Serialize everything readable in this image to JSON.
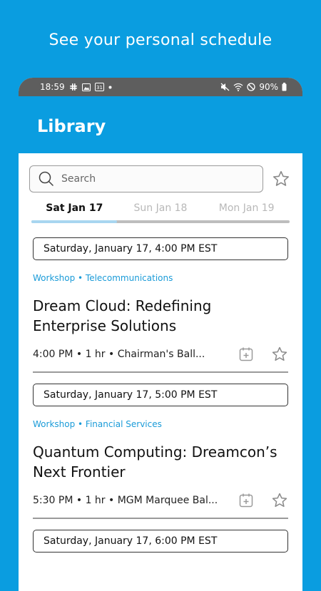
{
  "banner": {
    "text": "See your personal schedule"
  },
  "statusbar": {
    "time": "18:59",
    "battery": "90%",
    "calendar_day": "31"
  },
  "header": {
    "title": "Library"
  },
  "search": {
    "placeholder": "Search"
  },
  "tabs": [
    {
      "label": "Sat Jan 17",
      "active": true
    },
    {
      "label": "Sun Jan 18",
      "active": false
    },
    {
      "label": "Mon Jan 19",
      "active": false
    }
  ],
  "sessions": [
    {
      "time_header": "Saturday, January 17,  4:00 PM EST",
      "tags": "Workshop • Telecommunications",
      "title": "Dream Cloud: Redefining Enterprise Solutions",
      "meta": "4:00 PM • 1 hr • Chairman's Ball..."
    },
    {
      "time_header": "Saturday, January 17,  5:00 PM EST",
      "tags": "Workshop • Financial Services",
      "title": "Quantum Computing: Dreamcon’s Next Frontier",
      "meta": "5:30 PM • 1 hr • MGM Marquee Bal..."
    },
    {
      "time_header": "Saturday, January 17,  6:00 PM EST"
    }
  ],
  "colors": {
    "brand": "#0a9de0",
    "tag": "#1a9bd8",
    "status_bar": "#5e5e5e"
  }
}
